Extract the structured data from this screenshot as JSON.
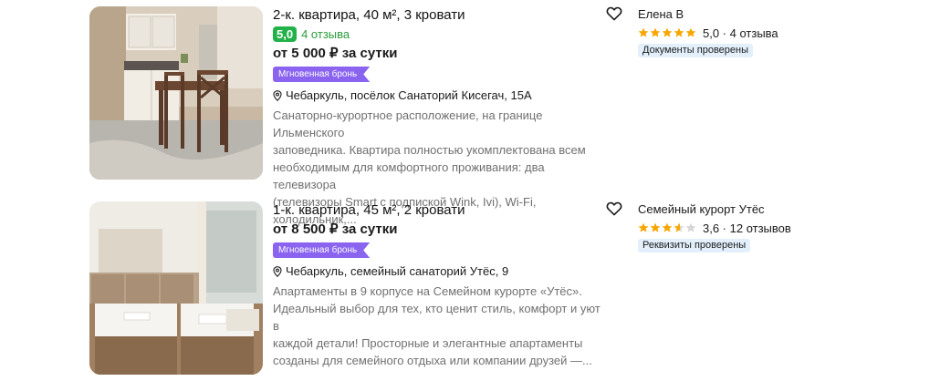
{
  "listings": [
    {
      "title": "2-к. квартира, 40 м², 3 кровати",
      "score": "5,0",
      "reviews": "4 отзыва",
      "price": "от 5 000 ₽ за сутки",
      "instant_badge": "Мгновенная бронь",
      "address": "Чебаркуль, посёлок Санаторий Кисегач, 15А",
      "description_lines": [
        "Санаторно-курортное расположение, на границе Ильменского",
        "заповедника. Квартира полностью укомплектована всем",
        "необходимым для комфортного проживания: два телевизора",
        "(телевизоры Smart с подпиской Wink, Ivi), Wi-Fi, холодильник,..."
      ],
      "host_name": "Елена В",
      "host_rating": 5.0,
      "host_rating_text": "5,0 · 4 отзыва",
      "verified_badge": "Документы проверены"
    },
    {
      "title": "1-к. квартира, 45 м², 2 кровати",
      "price": "от 8 500 ₽ за сутки",
      "instant_badge": "Мгновенная бронь",
      "address": "Чебаркуль, семейный санаторий Утёс, 9",
      "description_lines": [
        "Апартаменты в 9 корпусе на Семейном курорте «Утёс».",
        "Идеальный выбор для тех, кто ценит стиль, комфорт и уют в",
        "каждой детали! Просторные и элегантные апартаменты",
        "созданы для семейного отдыха или компании друзей —..."
      ],
      "host_name": "Семейный курорт Утёс",
      "host_rating": 3.6,
      "host_rating_text": "3,6 · 12 отзывов",
      "verified_badge": "Реквизиты проверены"
    }
  ],
  "colors": {
    "score_green": "#23b24a",
    "instant_purple": "#8a63f0",
    "star_gold": "#f7a600",
    "verified_bg": "#e3f0fc"
  }
}
